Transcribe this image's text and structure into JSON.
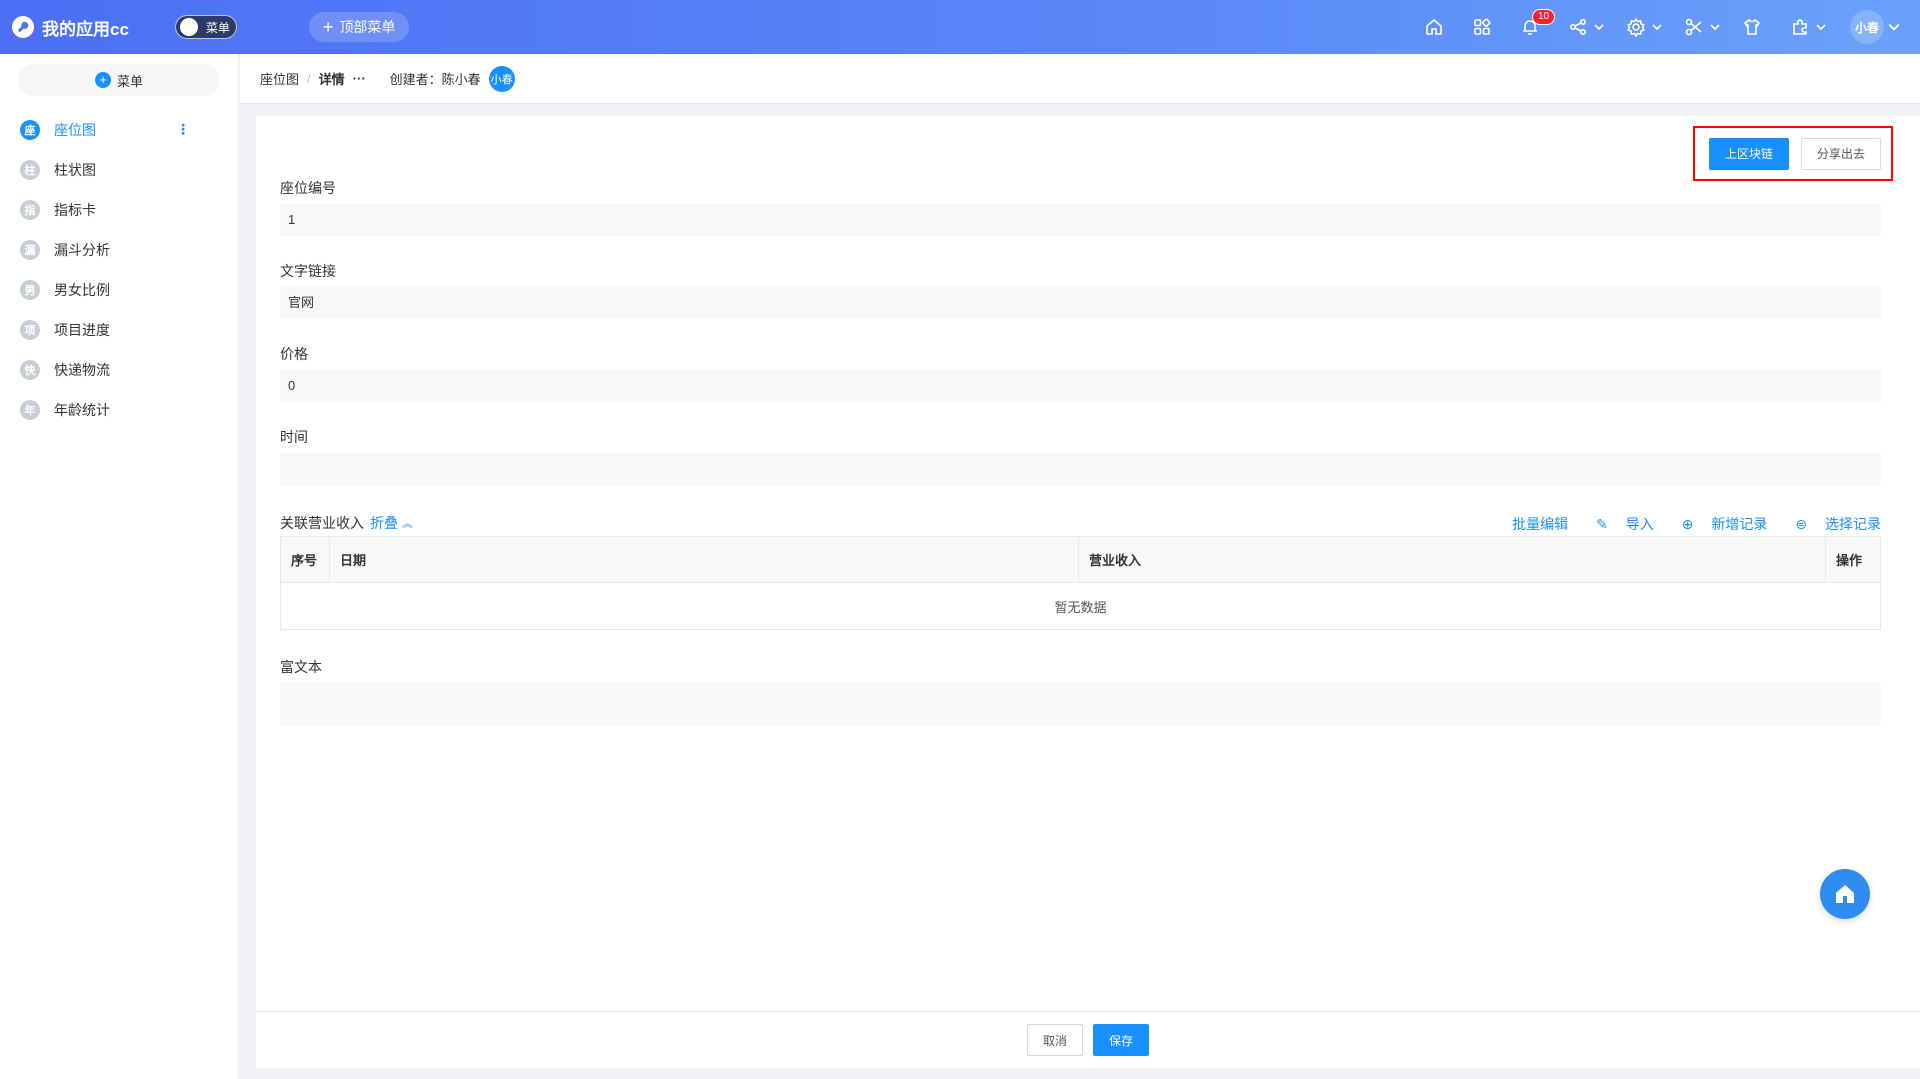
{
  "header": {
    "app_title": "我的应用cc",
    "menu_toggle_label": "菜单",
    "top_menu_label": "顶部菜单",
    "notification_count": "10",
    "user_name": "小春"
  },
  "sidebar": {
    "menu_button_label": "菜单",
    "items": [
      {
        "icon_char": "座",
        "label": "座位图",
        "active": true
      },
      {
        "icon_char": "柱",
        "label": "柱状图"
      },
      {
        "icon_char": "指",
        "label": "指标卡"
      },
      {
        "icon_char": "漏",
        "label": "漏斗分析"
      },
      {
        "icon_char": "男",
        "label": "男女比例"
      },
      {
        "icon_char": "项",
        "label": "项目进度"
      },
      {
        "icon_char": "快",
        "label": "快递物流"
      },
      {
        "icon_char": "年",
        "label": "年龄统计"
      }
    ]
  },
  "breadcrumb": {
    "parent": "座位图",
    "separator": "/",
    "current": "详情",
    "more": "···",
    "creator_label": "创建者：陈小春",
    "creator_avatar": "小春"
  },
  "actions": {
    "primary_label": "上区块链",
    "share_label": "分享出去"
  },
  "fields": [
    {
      "label": "座位编号",
      "value": "1"
    },
    {
      "label": "文字链接",
      "value": "官网"
    },
    {
      "label": "价格",
      "value": "0"
    },
    {
      "label": "时间",
      "value": ""
    }
  ],
  "related": {
    "title": "关联营业收入",
    "fold_label": "折叠",
    "fold_icon": "≈",
    "batch_edit": "批量编辑",
    "import_label": "导入",
    "add_record": "新增记录",
    "select_record": "选择记录",
    "columns": [
      "序号",
      "日期",
      "营业收入",
      "操作"
    ],
    "empty_text": "暂无数据"
  },
  "rich_text": {
    "label": "富文本"
  },
  "footer": {
    "cancel_label": "取消",
    "save_label": "保存"
  },
  "colors": {
    "primary": "#1890ff",
    "header_gradient_start": "#4c6ff5",
    "highlight_border": "#ff0000"
  }
}
